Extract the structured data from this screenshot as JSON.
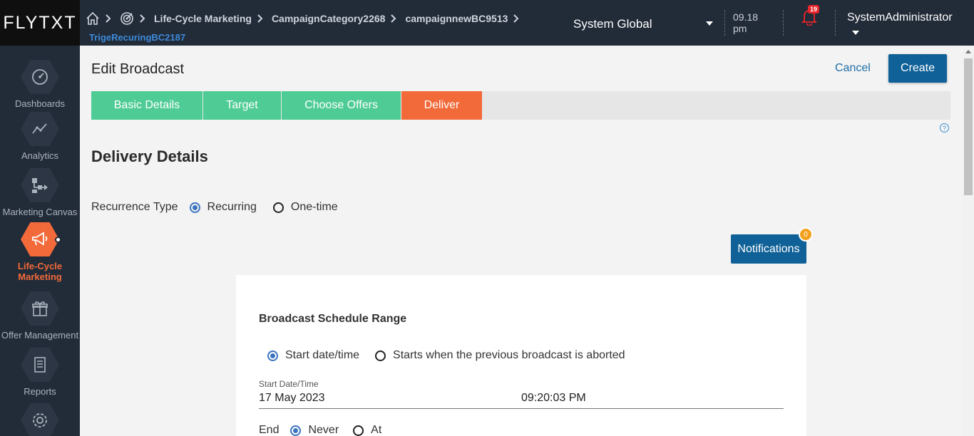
{
  "topbar": {
    "logo": "FLYTXT",
    "breadcrumbs": [
      "Life-Cycle Marketing",
      "CampaignCategory2268",
      "campaignnewBC9513"
    ],
    "breadcrumb_sub": "TrigeRecuringBC2187",
    "org": "System Global",
    "time_line1": "09.18",
    "time_line2": "pm",
    "notification_count": "19",
    "user": "SystemAdministrator"
  },
  "sidebar": {
    "items": [
      {
        "label": "Dashboards",
        "icon": "gauge-icon"
      },
      {
        "label": "Analytics",
        "icon": "line-graph-icon"
      },
      {
        "label": "Marketing Canvas",
        "icon": "flow-icon"
      },
      {
        "label": "Life-Cycle Marketing",
        "icon": "megaphone-icon"
      },
      {
        "label": "Offer Management",
        "icon": "gift-icon"
      },
      {
        "label": "Reports",
        "icon": "report-icon"
      },
      {
        "label": "",
        "icon": "settings-icon"
      }
    ]
  },
  "header": {
    "title": "Edit Broadcast",
    "cancel_label": "Cancel",
    "create_label": "Create"
  },
  "steps": [
    {
      "label": "Basic Details"
    },
    {
      "label": "Target"
    },
    {
      "label": "Choose Offers"
    },
    {
      "label": "Deliver"
    }
  ],
  "delivery": {
    "title": "Delivery Details",
    "recurrence_label": "Recurrence Type",
    "recurrence_options": [
      "Recurring",
      "One-time"
    ],
    "recurrence_selected": "Recurring",
    "notifications_label": "Notifications",
    "notifications_count": "0"
  },
  "schedule": {
    "title": "Broadcast Schedule Range",
    "start_options": [
      "Start date/time",
      "Starts when the previous broadcast is aborted"
    ],
    "start_selected": "Start date/time",
    "field_label": "Start Date/Time",
    "date": "17 May 2023",
    "time": "09:20:03 PM",
    "end_label": "End",
    "end_options": [
      "Never",
      "At"
    ],
    "end_selected": "Never"
  },
  "colors": {
    "topbar": "#222b38",
    "step_done": "#4fcc95",
    "step_current": "#f26a3a",
    "primary_button": "#0f6197",
    "accent_orange": "#f26a3a"
  }
}
